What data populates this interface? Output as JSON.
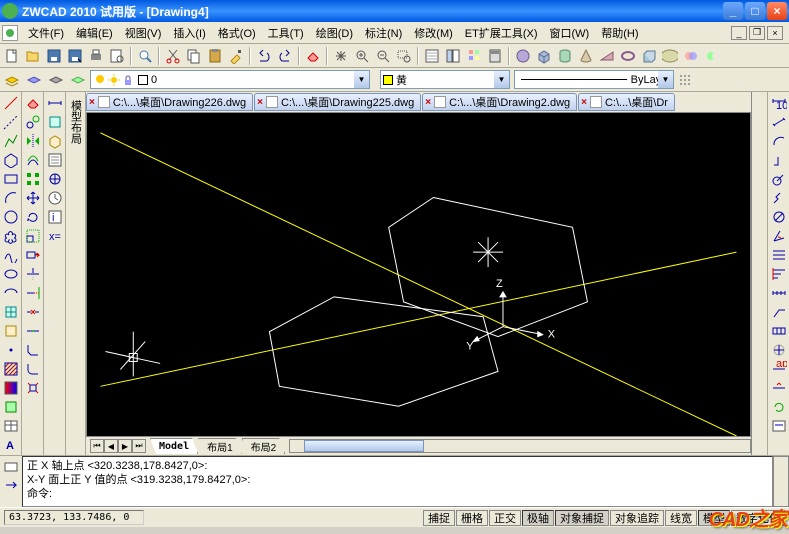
{
  "title": "ZWCAD 2010 试用版 - [Drawing4]",
  "menus": {
    "file": "文件(F)",
    "edit": "编辑(E)",
    "view": "视图(V)",
    "insert": "插入(I)",
    "format": "格式(O)",
    "tools": "工具(T)",
    "draw": "绘图(D)",
    "dim": "标注(N)",
    "modify": "修改(M)",
    "ext": "ET扩展工具(X)",
    "window": "窗口(W)",
    "help": "帮助(H)"
  },
  "layer": {
    "current": "0",
    "color": "黄",
    "linetype": "ByLayer"
  },
  "docs": [
    "C:\\...\\桌面\\Drawing226.dwg",
    "C:\\...\\桌面\\Drawing225.dwg",
    "C:\\...\\桌面\\Drawing2.dwg",
    "C:\\...\\桌面\\Dr"
  ],
  "sidetab": "模型布局",
  "layout_tabs": {
    "model": "Model",
    "l1": "布局1",
    "l2": "布局2"
  },
  "cmd": {
    "line1": "正 X 轴上点 <320.3238,178.8427,0>:",
    "line2": "X-Y 面上正 Y 值的点 <319.3238,179.8427,0>:",
    "prompt": "命令:"
  },
  "status": {
    "coord": "63.3723, 133.7486, 0",
    "snap": "捕捉",
    "grid": "栅格",
    "ortho": "正交",
    "polar": "极轴",
    "osnap": "对象捕捉",
    "otrack": "对象追踪",
    "lwt": "线宽",
    "model": "模型",
    "dyn": "数字化仪"
  },
  "axes": {
    "x": "X",
    "y": "Y",
    "z": "Z"
  },
  "watermark": "CAD之家"
}
